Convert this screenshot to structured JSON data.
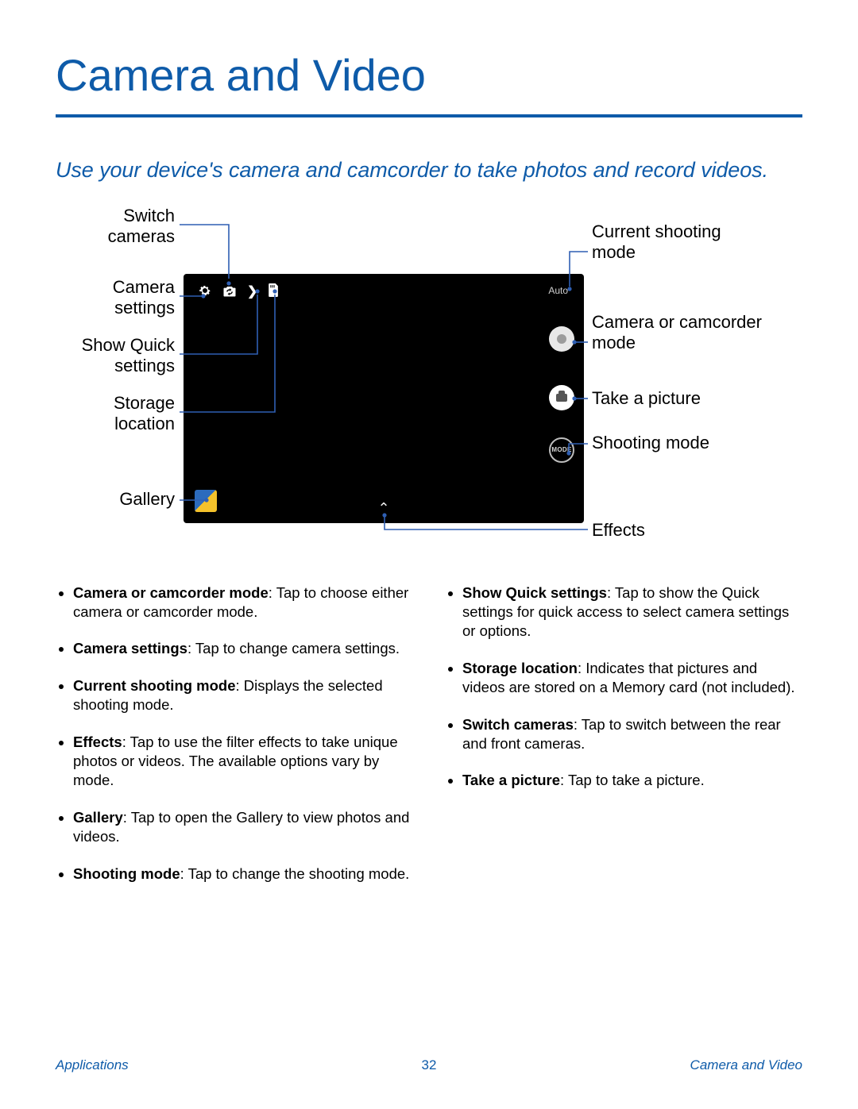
{
  "page": {
    "title": "Camera and Video",
    "intro": "Use your device's camera and camcorder to take photos and record videos.",
    "footer_left": "Applications",
    "footer_right": "Camera and Video",
    "page_number": "32"
  },
  "callouts": {
    "left": {
      "switch_cameras": "Switch cameras",
      "camera_settings": "Camera settings",
      "show_quick": "Show Quick settings",
      "storage": "Storage location",
      "gallery": "Gallery"
    },
    "right": {
      "current_mode": "Current shooting mode",
      "cam_or_vid": "Camera or camcorder mode",
      "take_picture": "Take a picture",
      "shooting_mode": "Shooting mode",
      "effects": "Effects"
    }
  },
  "shot": {
    "auto_label": "Auto",
    "mode_button_label": "MODE"
  },
  "bullets": {
    "left": [
      {
        "term": "Camera or camcorder mode",
        "desc": ": Tap to choose either camera or camcorder mode."
      },
      {
        "term": "Camera settings",
        "desc": ": Tap to change camera settings."
      },
      {
        "term": "Current shooting mode",
        "desc": ": Displays the selected shooting mode."
      },
      {
        "term": "Effects",
        "desc": ": Tap to use the filter effects to take unique photos or videos. The available options vary by mode."
      },
      {
        "term": "Gallery",
        "desc": ": Tap to open the Gallery to view photos and videos."
      },
      {
        "term": "Shooting mode",
        "desc": ": Tap to change the shooting mode."
      }
    ],
    "right": [
      {
        "term": "Show Quick settings",
        "desc": ": Tap to show the Quick settings for quick access to select camera settings or options."
      },
      {
        "term": "Storage location",
        "desc": ": Indicates that pictures and videos are stored on a Memory card (not included)."
      },
      {
        "term": "Switch cameras",
        "desc": ": Tap to switch between the rear and front cameras."
      },
      {
        "term": "Take a picture",
        "desc": ": Tap to take a picture."
      }
    ]
  }
}
